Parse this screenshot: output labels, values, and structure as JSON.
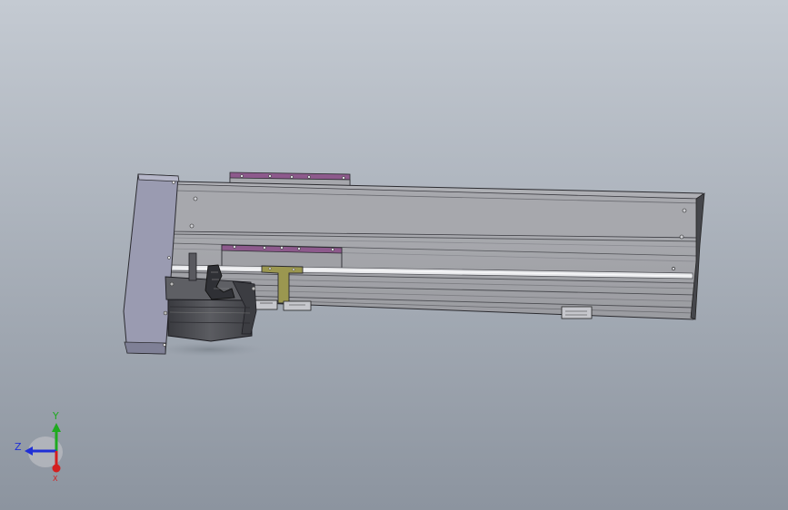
{
  "viewport": {
    "background_top": "#c3c9d1",
    "background_bottom": "#8e96a1"
  },
  "model": {
    "body_color": "#a3a4a9",
    "body_dark": "#55565b",
    "bracket_color": "#8e8fa6",
    "carriage_accent": "#8d5a8c",
    "t_bracket_color": "#9b9750",
    "motor_color": "#4a4b50",
    "rod_color": "#e6e7ea"
  },
  "triad": {
    "labels": {
      "y": "Y",
      "z": "Z",
      "x": "X"
    },
    "colors": {
      "y": "#1faa1f",
      "z": "#1f2fd6",
      "x": "#d41f1f"
    }
  }
}
